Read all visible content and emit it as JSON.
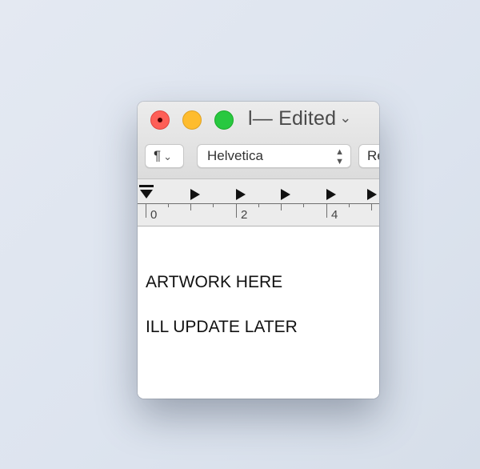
{
  "window": {
    "title": "l— Edited",
    "title_chevron": "⌄"
  },
  "toolbar": {
    "paragraph_label": "¶",
    "paragraph_chevron": "⌄",
    "font_name": "Helvetica",
    "style_label": "Re"
  },
  "ruler": {
    "numbers": [
      "0",
      "2",
      "4"
    ]
  },
  "document": {
    "lines": [
      "ARTWORK HERE",
      "ILL UPDATE LATER"
    ]
  },
  "colors": {
    "close": "#fe5f57",
    "minimize": "#febc2e",
    "zoom": "#28c840"
  },
  "icons": [
    "close-button-icon",
    "chevron-down-icon",
    "up-down-arrows-icon",
    "tab-stop-icon",
    "margin-marker-icon"
  ]
}
